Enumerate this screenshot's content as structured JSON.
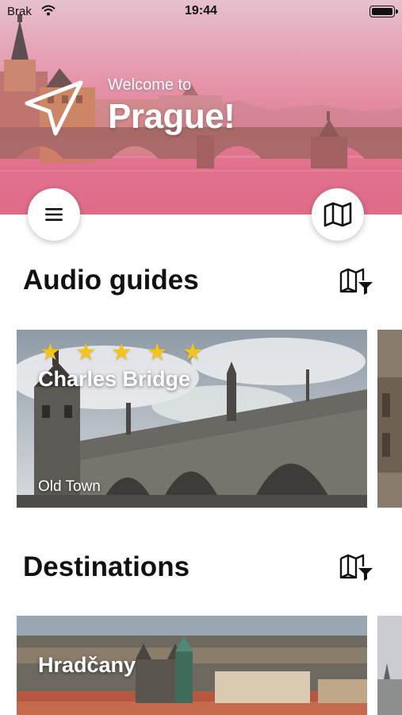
{
  "status_bar": {
    "carrier": "Brak",
    "time": "19:44"
  },
  "hero": {
    "welcome": "Welcome to",
    "city": "Prague!"
  },
  "sections": {
    "audio_guides": {
      "title": "Audio guides"
    },
    "destinations": {
      "title": "Destinations"
    }
  },
  "audio_guides": [
    {
      "title": "Charles Bridge",
      "subtitle": "Old Town",
      "rating": 5
    }
  ],
  "destinations": [
    {
      "title": "Hradčany"
    }
  ],
  "colors": {
    "star": "#f3c41a",
    "hero_tint": "#e08398"
  },
  "icons": {
    "menu": "hamburger-icon",
    "map": "folded-map-icon",
    "filter": "map-filter-icon",
    "location": "navigation-arrow-icon"
  }
}
